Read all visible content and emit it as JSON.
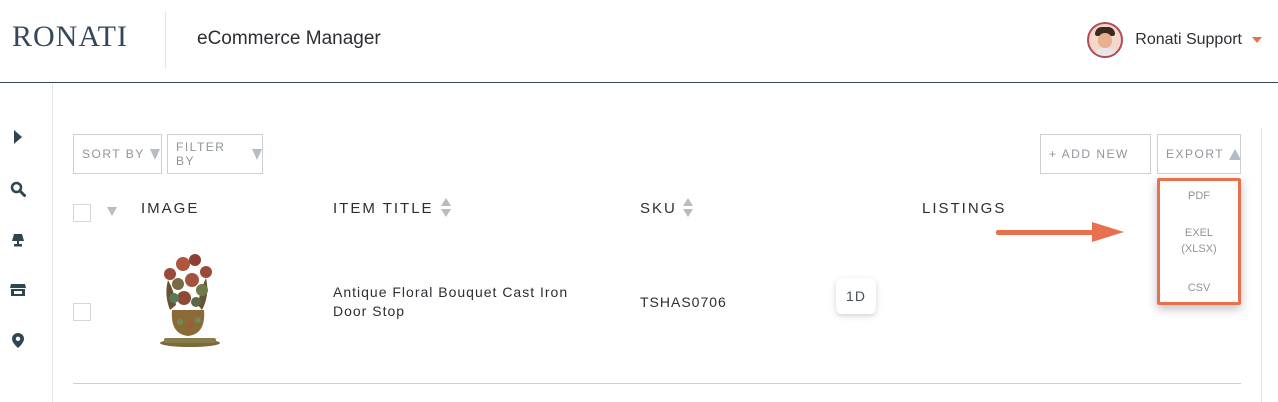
{
  "header": {
    "logo": "RONATI",
    "app_title": "eCommerce Manager",
    "user_name": "Ronati Support"
  },
  "sidebar": {
    "items": [
      {
        "icon": "expand-arrow-icon"
      },
      {
        "icon": "search-icon"
      },
      {
        "icon": "lamp-icon"
      },
      {
        "icon": "store-icon"
      },
      {
        "icon": "location-pin-icon"
      }
    ]
  },
  "toolbar": {
    "sort_label": "SORT BY",
    "filter_label": "FILTER BY",
    "add_new_label": "+ ADD NEW",
    "export_label": "EXPORT"
  },
  "export_menu": {
    "options": [
      "PDF",
      "EXEL\n(XLSX)",
      "CSV"
    ]
  },
  "table": {
    "columns": {
      "image": "IMAGE",
      "item_title": "ITEM TITLE",
      "sku": "SKU",
      "listings": "LISTINGS"
    },
    "rows": [
      {
        "title": "Antique Floral Bouquet Cast Iron Door Stop",
        "sku": "TSHAS0706",
        "listing_badge": "1D"
      }
    ]
  },
  "colors": {
    "accent": "#e8704f",
    "navy": "#2f4552",
    "muted_text": "#8e959b"
  }
}
